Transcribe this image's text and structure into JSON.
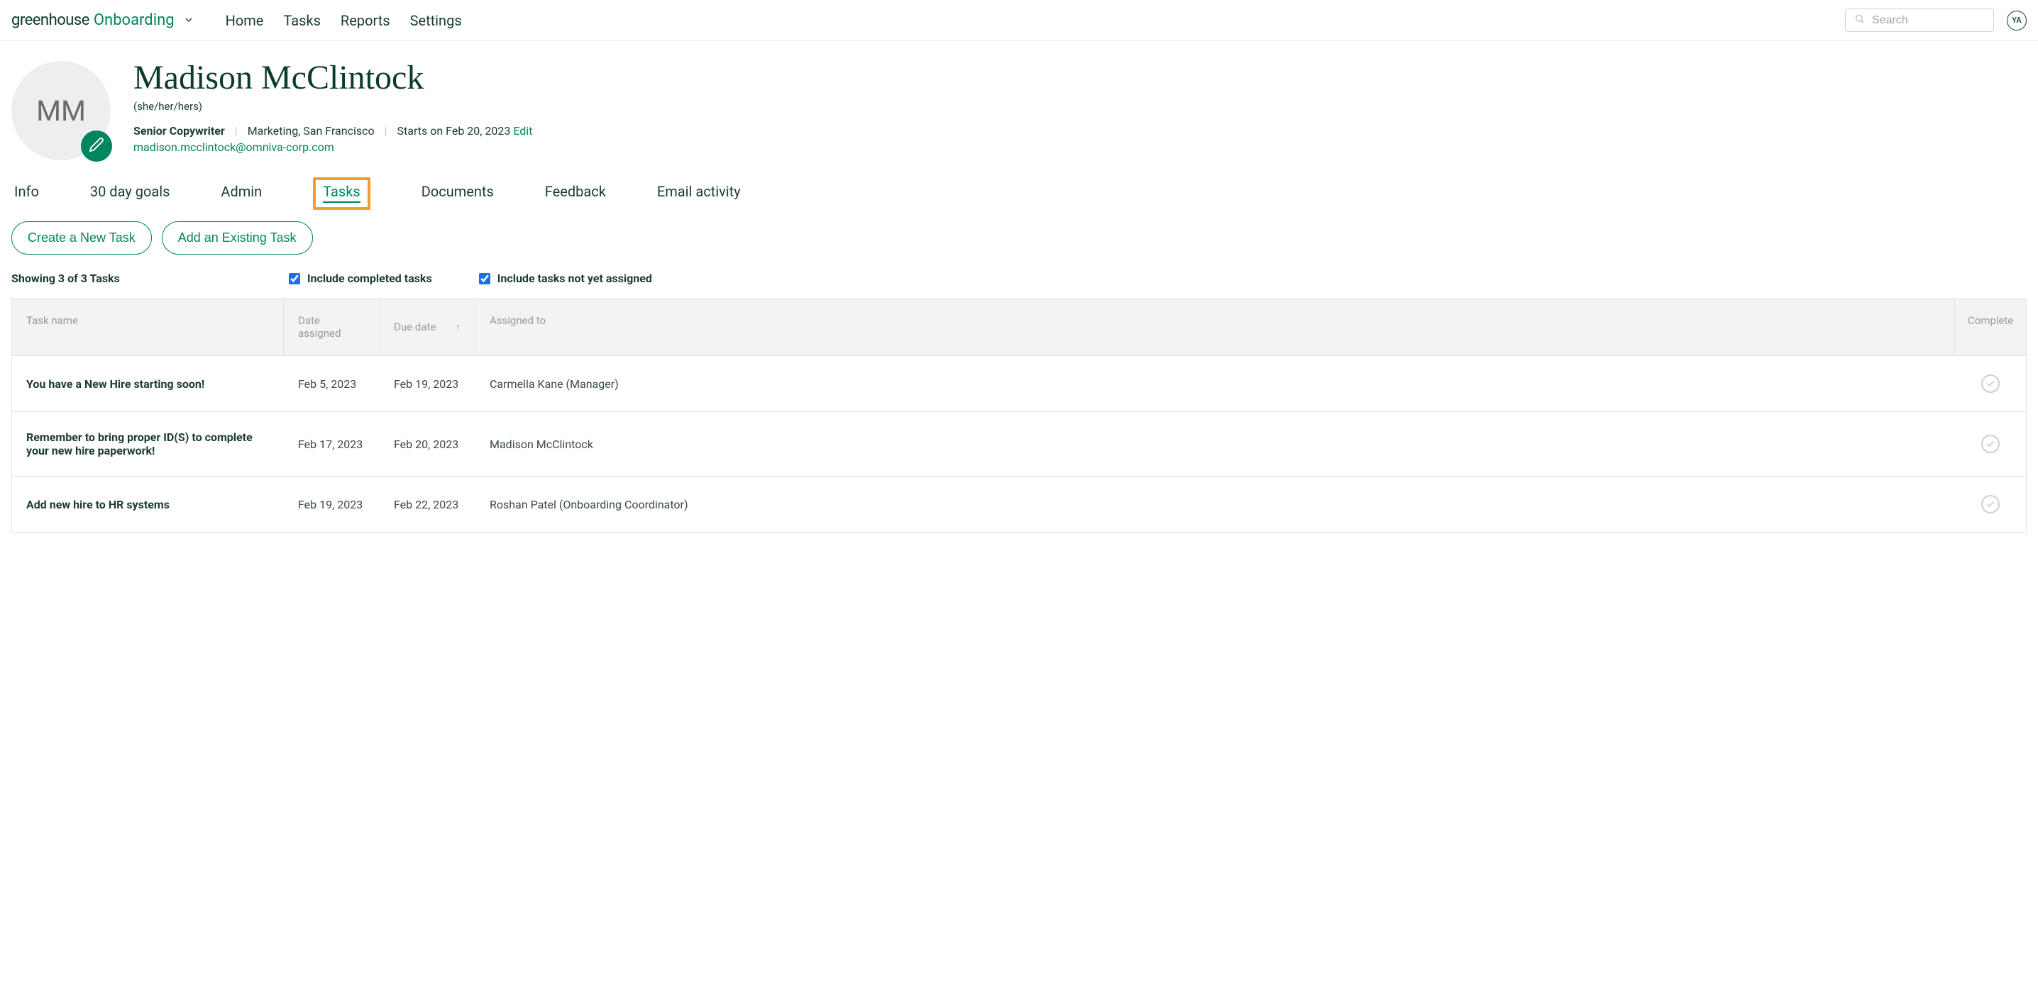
{
  "brand": {
    "greenhouse": "greenhouse",
    "onboarding": "Onboarding"
  },
  "nav": {
    "home": "Home",
    "tasks": "Tasks",
    "reports": "Reports",
    "settings": "Settings"
  },
  "search": {
    "placeholder": "Search"
  },
  "user_badge": "YA",
  "profile": {
    "initials": "MM",
    "name": "Madison McClintock",
    "pronouns": "(she/her/hers)",
    "title": "Senior Copywriter",
    "department_location": "Marketing, San Francisco",
    "start_text": "Starts on Feb 20, 2023",
    "edit": "Edit",
    "email": "madison.mcclintock@omniva-corp.com"
  },
  "tabs": {
    "info": "Info",
    "goals": "30 day goals",
    "admin": "Admin",
    "tasks": "Tasks",
    "documents": "Documents",
    "feedback": "Feedback",
    "email": "Email activity"
  },
  "actions": {
    "create": "Create a New Task",
    "add_existing": "Add an Existing Task"
  },
  "filters": {
    "showing": "Showing 3 of 3 Tasks",
    "include_completed": "Include completed tasks",
    "include_unassigned": "Include tasks not yet assigned"
  },
  "table": {
    "headers": {
      "name": "Task name",
      "date_assigned": "Date assigned",
      "due": "Due date",
      "assigned_to": "Assigned to",
      "complete": "Complete"
    },
    "rows": [
      {
        "name": "You have a New Hire starting soon!",
        "date_assigned": "Feb 5, 2023",
        "due": "Feb 19, 2023",
        "assigned_to": "Carmella Kane (Manager)"
      },
      {
        "name": "Remember to bring proper ID(S) to complete your new hire paperwork!",
        "date_assigned": "Feb 17, 2023",
        "due": "Feb 20, 2023",
        "assigned_to": "Madison McClintock"
      },
      {
        "name": "Add new hire to HR systems",
        "date_assigned": "Feb 19, 2023",
        "due": "Feb 22, 2023",
        "assigned_to": "Roshan Patel (Onboarding Coordinator)"
      }
    ]
  }
}
